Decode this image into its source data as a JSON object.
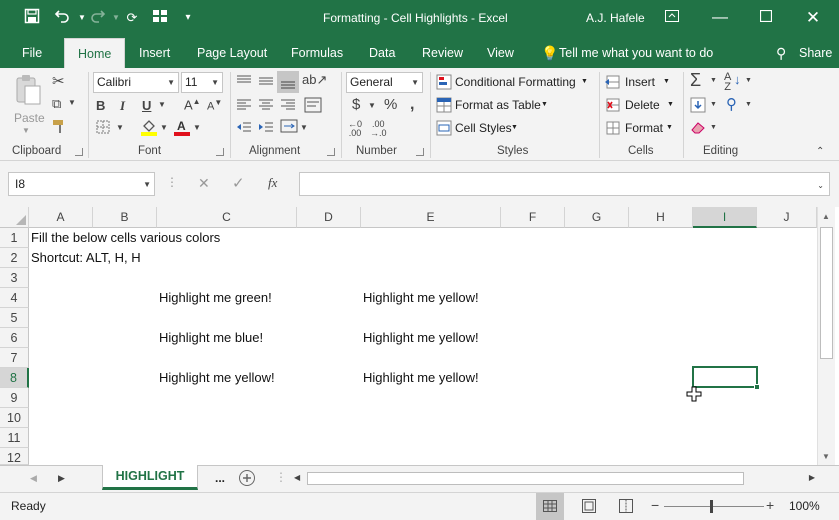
{
  "window": {
    "title": "Formatting - Cell Highlights  -  Excel",
    "user": "A.J. Hafele"
  },
  "tabs": [
    "File",
    "Home",
    "Insert",
    "Page Layout",
    "Formulas",
    "Data",
    "Review",
    "View"
  ],
  "tell_me": "Tell me what you want to do",
  "share": "Share",
  "ribbon": {
    "clipboard": {
      "paste": "Paste",
      "label": "Clipboard"
    },
    "font": {
      "name": "Calibri",
      "size": "11",
      "label": "Font"
    },
    "alignment": {
      "label": "Alignment"
    },
    "number": {
      "format": "General",
      "label": "Number"
    },
    "styles": {
      "conditional": "Conditional Formatting",
      "table": "Format as Table",
      "cell_styles": "Cell Styles",
      "label": "Styles"
    },
    "cells": {
      "insert": "Insert",
      "delete": "Delete",
      "format": "Format",
      "label": "Cells"
    },
    "editing": {
      "label": "Editing"
    }
  },
  "formula_bar": {
    "name_box": "I8",
    "fx": "fx",
    "value": ""
  },
  "columns": [
    "A",
    "B",
    "C",
    "D",
    "E",
    "F",
    "G",
    "H",
    "I",
    "J"
  ],
  "rows": [
    "1",
    "2",
    "3",
    "4",
    "5",
    "6",
    "7",
    "8",
    "9",
    "10",
    "11",
    "12"
  ],
  "cells": {
    "A1": "Fill the below cells various colors",
    "A2": "Shortcut: ALT, H, H",
    "C4": "Highlight me green!",
    "E4": "Highlight me yellow!",
    "C6": "Highlight me blue!",
    "E6": "Highlight me yellow!",
    "C8": "Highlight me yellow!",
    "E8": "Highlight me yellow!"
  },
  "sheet_tabs": {
    "active": "HIGHLIGHT",
    "more": "..."
  },
  "status": {
    "ready": "Ready",
    "zoom": "100%"
  },
  "colors": {
    "accent": "#217346",
    "ribbon_bg": "#f3f3f3"
  }
}
